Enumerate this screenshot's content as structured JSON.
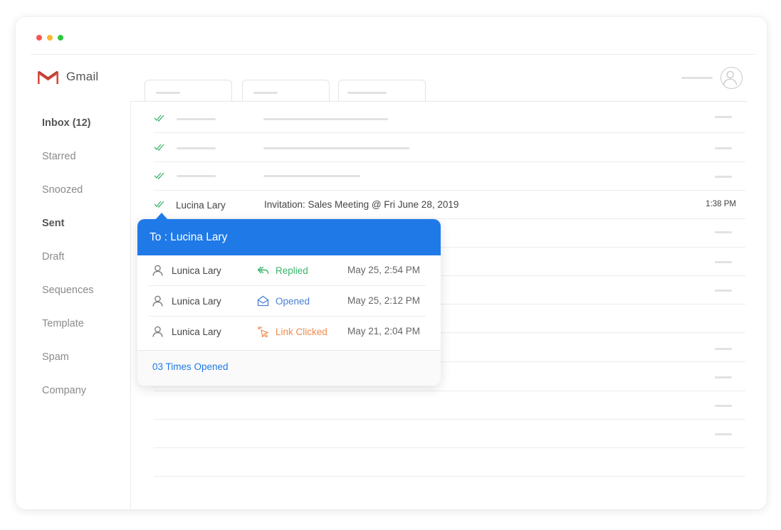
{
  "app": {
    "name": "Gmail"
  },
  "sidebar": {
    "items": [
      {
        "label": "Inbox (12)"
      },
      {
        "label": "Starred"
      },
      {
        "label": "Snoozed"
      },
      {
        "label": "Sent"
      },
      {
        "label": "Draft"
      },
      {
        "label": "Sequences"
      },
      {
        "label": "Template"
      },
      {
        "label": "Spam"
      },
      {
        "label": "Company"
      }
    ]
  },
  "email": {
    "sender": "Lucina Lary",
    "subject": "Invitation: Sales Meeting @ Fri June 28, 2019",
    "time": "1:38 PM"
  },
  "popup": {
    "title": "To : Lucina Lary",
    "rows": [
      {
        "name": "Lunica Lary",
        "status": "Replied",
        "status_icon": "reply-icon",
        "status_color": "#3cb46e",
        "date": "May 25, 2:54 PM"
      },
      {
        "name": "Lunica Lary",
        "status": "Opened",
        "status_icon": "envelope-open-icon",
        "status_color": "#4a7fd4",
        "date": "May 25, 2:12 PM"
      },
      {
        "name": "Lunica Lary",
        "status": "Link Clicked",
        "status_icon": "cursor-click-icon",
        "status_color": "#f08a4b",
        "date": "May 21, 2:04 PM"
      }
    ],
    "footer": "03 Times Opened"
  },
  "colors": {
    "accent": "#1f7ae8",
    "check": "#3cb46e"
  }
}
